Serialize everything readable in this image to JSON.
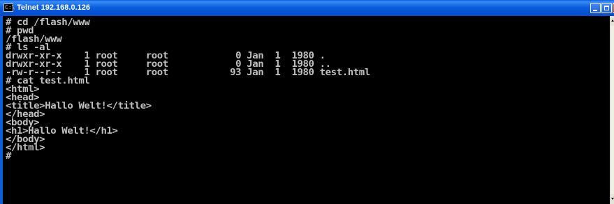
{
  "window": {
    "title": "Telnet 192.168.0.126",
    "app_icon": "C:\\",
    "controls": [
      "minimize-icon",
      "maximize-icon",
      "close-icon"
    ]
  },
  "console": {
    "lines": [
      "# cd /flash/www",
      "# pwd",
      "/flash/www",
      "# ls -al",
      "drwxr-xr-x    1 root     root            0 Jan  1  1980 .",
      "drwxr-xr-x    1 root     root            0 Jan  1  1980 ..",
      "-rw-r--r--    1 root     root           93 Jan  1  1980 test.html",
      "# cat test.html",
      "<html>",
      "<head>",
      "<title>Hallo Welt!</title>",
      "</head>",
      "<body>",
      "<h1>Hallo Welt!</h1>",
      "</body>",
      "</html>",
      "#"
    ]
  },
  "colors": {
    "console_bg": "#000000",
    "console_fg": "#c0c0c0",
    "titlebar": "#0a5ee0"
  }
}
